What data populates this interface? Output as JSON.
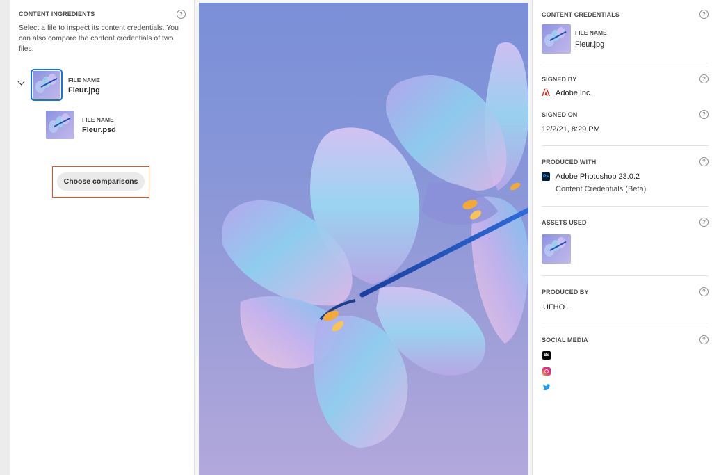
{
  "left_panel": {
    "heading": "CONTENT INGREDIENTS",
    "description": "Select a file to inspect its content credentials. You can also compare the content credentials of two files.",
    "files": [
      {
        "label": "FILE NAME",
        "name": "Fleur.jpg"
      },
      {
        "label": "FILE NAME",
        "name": "Fleur.psd"
      }
    ],
    "choose_button": "Choose comparisons"
  },
  "right_panel": {
    "credentials_heading": "CONTENT CREDENTIALS",
    "file_label": "FILE NAME",
    "file_name": "Fleur.jpg",
    "signed_by_heading": "SIGNED BY",
    "signed_by": "Adobe Inc.",
    "signed_on_heading": "SIGNED ON",
    "signed_on": "12/2/21, 8:29 PM",
    "produced_with_heading": "PRODUCED WITH",
    "produced_with": "Adobe Photoshop 23.0.2",
    "produced_with_sub": "Content Credentials (Beta)",
    "assets_heading": "ASSETS USED",
    "produced_by_heading": "PRODUCED BY",
    "produced_by": "UFHO .",
    "social_heading": "SOCIAL MEDIA",
    "social_icons": [
      "behance-icon",
      "instagram-icon",
      "twitter-icon"
    ]
  },
  "icons": {
    "help": "?",
    "ps_logo_text": "Ps",
    "behance_text": "Bē"
  },
  "colors": {
    "accent": "#1473e6",
    "highlight": "#d85a2a",
    "adobe_red": "#e1251b"
  }
}
